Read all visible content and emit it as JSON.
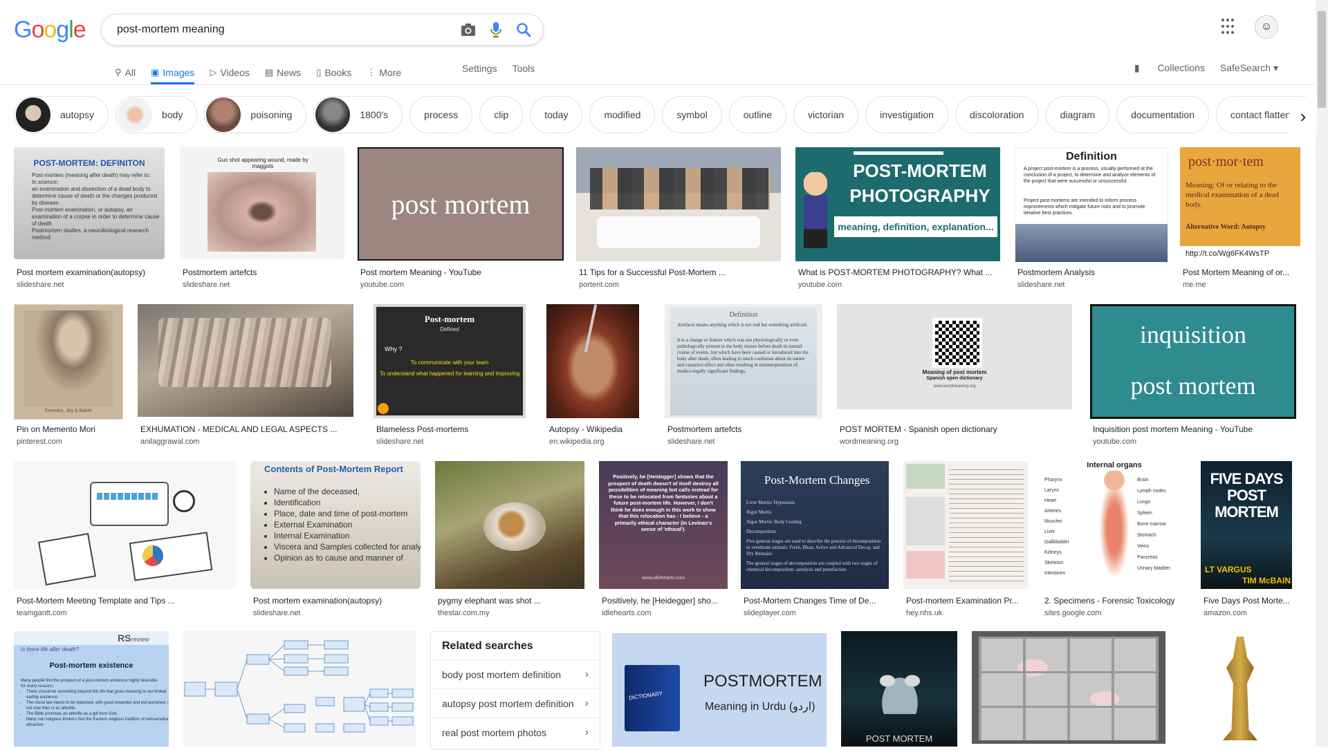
{
  "logo": {
    "g1": "G",
    "o1": "o",
    "o2": "o",
    "g2": "g",
    "l": "l",
    "e": "e"
  },
  "search": {
    "value": "post-mortem meaning"
  },
  "tabs": [
    {
      "label": "All",
      "icon": "search-icon"
    },
    {
      "label": "Images",
      "icon": "image-icon"
    },
    {
      "label": "Videos",
      "icon": "video-icon"
    },
    {
      "label": "News",
      "icon": "news-icon"
    },
    {
      "label": "Books",
      "icon": "book-icon"
    },
    {
      "label": "More",
      "icon": "more-icon"
    }
  ],
  "tools": {
    "settings": "Settings",
    "tools": "Tools"
  },
  "right_tabs": {
    "collections": "Collections",
    "safesearch": "SafeSearch ▾"
  },
  "chips": [
    "autopsy",
    "body",
    "poisoning",
    "1800's",
    "process",
    "clip",
    "today",
    "modified",
    "symbol",
    "outline",
    "victorian",
    "investigation",
    "discoloration",
    "diagram",
    "documentation",
    "contact flattening"
  ],
  "row1": [
    {
      "caption": "Post mortem examination(autopsy)",
      "source": "slideshare.net"
    },
    {
      "caption": "Postmortem artefcts",
      "source": "slideshare.net"
    },
    {
      "caption": "Post mortem Meaning - YouTube",
      "source": "youtube.com"
    },
    {
      "caption": "11 Tips for a Successful Post-Mortem ...",
      "source": "portent.com"
    },
    {
      "caption": "What is POST-MORTEM PHOTOGRAPHY? What ...",
      "source": "youtube.com"
    },
    {
      "caption": "Postmortem Analysis",
      "source": "slideshare.net"
    },
    {
      "caption": "Post Mortem Meaning of or...",
      "source": "me.me"
    }
  ],
  "row2": [
    {
      "caption": "Pin on Memento Mori",
      "source": "pinterest.com"
    },
    {
      "caption": "EXHUMATION - MEDICAL AND LEGAL ASPECTS ...",
      "source": "anilaggrawal.com"
    },
    {
      "caption": "Blameless Post-mortems",
      "source": "slideshare.net"
    },
    {
      "caption": "Autopsy - Wikipedia",
      "source": "en.wikipedia.org"
    },
    {
      "caption": "Postmortem artefcts",
      "source": "slideshare.net"
    },
    {
      "caption": "POST MORTEM - Spanish open dictionary",
      "source": "wordmeaning.org"
    },
    {
      "caption": "Inquisition post mortem Meaning - YouTube",
      "source": "youtube.com"
    }
  ],
  "row3": [
    {
      "caption": "Post-Mortem Meeting Template and Tips ...",
      "source": "teamgantt.com"
    },
    {
      "caption": "Post mortem examination(autopsy)",
      "source": "slideshare.net"
    },
    {
      "caption": "pygmy elephant was shot ...",
      "source": "thestar.com.my"
    },
    {
      "caption": "Positively, he [Heidegger] sho...",
      "source": "idlehearts.com"
    },
    {
      "caption": "Post-Mortem Changes Time of De...",
      "source": "slideplayer.com"
    },
    {
      "caption": "Post-mortem Examination Pr...",
      "source": "hey.nhs.uk"
    },
    {
      "caption": "2. Specimens - Forensic Toxicology",
      "source": "sites.google.com"
    },
    {
      "caption": "Five Days Post Morte...",
      "source": "amazon.com"
    }
  ],
  "related": {
    "title": "Related searches",
    "items": [
      "body post mortem definition",
      "autopsy post mortem definition",
      "real post mortem photos"
    ]
  },
  "img_text": {
    "def_title": "POST-MORTEM: DEFINITON",
    "def_lines": [
      "Post-mortem (meaning after death) may refer to:",
      "In science:",
      "an examination and dissection of a dead body to determine cause of death or the changes produced by disease.",
      "Post-mortem examination, or autopsy, an examination of a corpse in order to determine cause of death",
      "Postmortem studies, a neurobiological research method"
    ],
    "gunshot": "Gun shot appearing wound, made by maggots",
    "pm_big": "post mortem",
    "photo_title1": "POST-MORTEM",
    "photo_title2": "PHOTOGRAPHY",
    "photo_sub": "meaning, definition, explanation...",
    "definition_head": "Definition",
    "definition_body": "A project post-mortem is a process, usually performed at the conclusion of a project, to determine and analyze elements of the project that were successful or unsuccessful",
    "definition_body2": "Project post-mortems are intended to inform process improvements which mitigate future risks and to promote iterative best practices.",
    "memem_title": "post·mor·tem",
    "memem_body": "Meaning: Of or relating to the medical examination of a dead body.",
    "memem_alt": "Alternative Word: Autopsy",
    "memem_url": "http://t.co/Wg6FK4WsTP",
    "memento_caption": "Knowles, Joy & Baker",
    "blameless_title": "Post-mortem",
    "blameless_sub": "Defined",
    "blameless_why": "Why ?",
    "blameless_l1": "To communicate with your team",
    "blameless_l2": "To understand what happened for learning and improving",
    "artefact_head": "Definition",
    "artefact_body": "Artefacts means anything which is not real but something artificial.",
    "artefact_body2": "It is a change or feature which was not physiologically or even pathologically present in the body tissues before death in natural course of events, but which have been caused or introduced into the body after death, often leading to much confusion about its nature and causative effect and often resulting in misinterpretation of medico-legally significant findings.",
    "qr_cap1": "Meaning of post mortem",
    "qr_cap2": "Spanish open dictionary",
    "qr_cap3": "www.wordmeaning.org",
    "inq1": "inquisition",
    "inq2": "post mortem",
    "report_head": "Contents of Post-Mortem Report",
    "report_items": [
      "Name of the deceased,",
      "Identification",
      "Place, date and time of post-mortem",
      "External Examination",
      "Internal Examination",
      "Viscera and Samples collected for analysis",
      "Opinion as to cause and manner of"
    ],
    "heid": "Positively, he [Heidegger] shows that the prospect of death doesn't of itself destroy all possibilities of meaning but calls instead for these to be relocated from fantasies about a future post-mortem life. However, I don't think he does enough in this work to show that this relocation has - I believe - a primarily ethical character (in Levinas's sense of 'ethical').",
    "heid_src": "www.idlehearts.com",
    "changes_title": "Post-Mortem Changes",
    "changes_items": [
      "Livor Mortis/ Hypostasis",
      "Rigor Mortis",
      "Algor Mortis/ Body Cooling",
      "Decomposition",
      "Five general stages are used to describe the process of decomposition in vertebrate animals: Fresh, Bloat, Active and Advanced Decay, and Dry Remains",
      "The general stages of decomposition are coupled with two stages of chemical decomposition: autolysis and putrefaction"
    ],
    "organs_title": "Internal organs",
    "organs_left": [
      "Pharynx",
      "Larynx",
      "Heart",
      "Arteries",
      "Muscles",
      "Liver",
      "Gallbladder",
      "Kidneys",
      "Skeleton",
      "Intestines"
    ],
    "organs_right": [
      "Brain",
      "Lymph nodes",
      "Lungs",
      "Spleen",
      "Bone marrow",
      "Stomach",
      "Veins",
      "Pancreas",
      "Urinary bladder"
    ],
    "fd1": "FIVE DAYS",
    "fd2": "POST MORTEM",
    "fd_author1": "LT VARGUS",
    "fd_author2": "TIM McBAIN",
    "rs_logo": "RS",
    "rs_review": "review",
    "rs_q": "Is there life after death?",
    "rs_title": "Post-mortem existence",
    "rs_body": "Many people find the prospect of a post-mortem existence highly desirable for many reasons:",
    "rs_b1": "There should be something beyond this life that gives meaning to our limited earthly existence.",
    "rs_b2": "The moral law needs to be balanced, with good rewarded and evil punished, if not now then in an afterlife.",
    "rs_b3": "The Bible promises an afterlife as a gift from God.",
    "rs_b4": "Many non-religious thinkers find the Eastern religious tradition of reincarnation attractive.",
    "dict_word": "POSTMORTEM",
    "dict_sub": "Meaning in Urdu (اردو)",
    "dict_book": "DICTIONARY",
    "film_title": "POST MORTEM"
  },
  "colors": {
    "accent": "#1a73e8",
    "text": "#202124",
    "muted": "#5f6368",
    "teal": "#1d6b6f",
    "navy": "#1f2b4d"
  }
}
